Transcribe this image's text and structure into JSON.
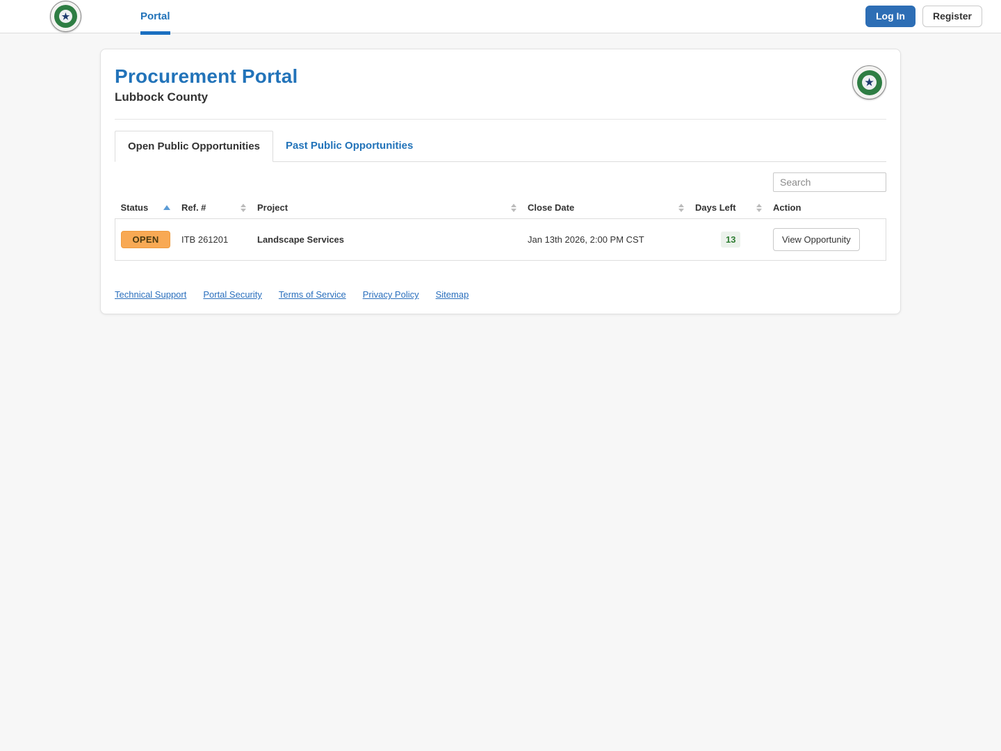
{
  "navbar": {
    "nav_portal_label": "Portal",
    "login_label": "Log In",
    "register_label": "Register"
  },
  "icons": {
    "seal_star": "★"
  },
  "page": {
    "title": "Procurement Portal",
    "subtitle": "Lubbock County"
  },
  "tabs": [
    {
      "label": "Open Public Opportunities",
      "active": true
    },
    {
      "label": "Past Public Opportunities",
      "active": false
    }
  ],
  "search": {
    "placeholder": "Search"
  },
  "table": {
    "columns": [
      {
        "label": "Status",
        "sort": "asc"
      },
      {
        "label": "Ref. #",
        "sort": "both"
      },
      {
        "label": "Project",
        "sort": "both"
      },
      {
        "label": "Close Date",
        "sort": "both"
      },
      {
        "label": "Days Left",
        "sort": "both"
      },
      {
        "label": "Action",
        "sort": "none"
      }
    ],
    "rows": [
      {
        "status": "OPEN",
        "ref": "ITB 261201",
        "project": "Landscape Services",
        "close_date": "Jan 13th 2026, 2:00 PM CST",
        "days_left": "13",
        "action_label": "View Opportunity"
      }
    ]
  },
  "footer": {
    "links": [
      "Technical Support",
      "Portal Security",
      "Terms of Service",
      "Privacy Policy",
      "Sitemap"
    ]
  },
  "colors": {
    "accent_blue": "#2273b9",
    "login_button_blue": "#2d6eb5",
    "open_badge_bg": "#f8a954",
    "days_left_green": "#2f7d33",
    "page_background": "#f7f7f7"
  }
}
